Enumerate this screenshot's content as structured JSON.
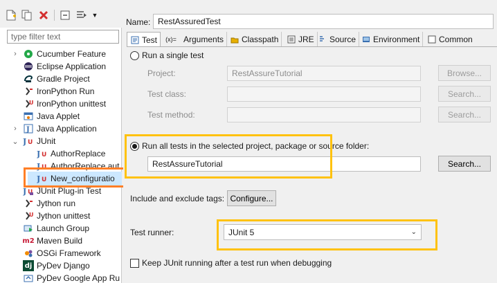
{
  "toolbar": {
    "new_icon": "new-launch-config-icon",
    "duplicate_icon": "duplicate-icon",
    "delete_icon": "delete-icon",
    "collapse_icon": "collapse-all-icon",
    "filter_icon": "filter-icon"
  },
  "filter": {
    "placeholder": "type filter text"
  },
  "tree": [
    {
      "label": "Cucumber Feature",
      "icon": "cucumber-icon"
    },
    {
      "label": "Eclipse Application",
      "icon": "eclipse-icon"
    },
    {
      "label": "Gradle Project",
      "icon": "gradle-icon"
    },
    {
      "label": "IronPython Run",
      "icon": "python-run-icon"
    },
    {
      "label": "IronPython unittest",
      "icon": "python-unittest-icon"
    },
    {
      "label": "Java Applet",
      "icon": "java-applet-icon"
    },
    {
      "label": "Java Application",
      "icon": "java-app-icon"
    },
    {
      "label": "JUnit",
      "icon": "junit-icon"
    },
    {
      "label": "AuthorReplace",
      "icon": "junit-icon"
    },
    {
      "label": "AuthorReplace aut",
      "icon": "junit-icon"
    },
    {
      "label": "New_configuratio",
      "icon": "junit-icon"
    },
    {
      "label": "JUnit Plug-in Test",
      "icon": "junit-plugin-icon"
    },
    {
      "label": "Jython run",
      "icon": "python-run-icon"
    },
    {
      "label": "Jython unittest",
      "icon": "python-unittest-icon"
    },
    {
      "label": "Launch Group",
      "icon": "launch-group-icon"
    },
    {
      "label": "Maven Build",
      "icon": "maven-icon"
    },
    {
      "label": "OSGi Framework",
      "icon": "osgi-icon"
    },
    {
      "label": "PyDev Django",
      "icon": "django-icon"
    },
    {
      "label": "PyDev Google App Ru",
      "icon": "google-app-icon"
    }
  ],
  "name_label": "Name:",
  "name_value": "RestAssuredTest",
  "tabs": [
    "Test",
    "Arguments",
    "Classpath",
    "JRE",
    "Source",
    "Environment",
    "Common"
  ],
  "run_single_label": "Run a single test",
  "project_label": "Project:",
  "project_value": "RestAssureTutorial",
  "browse_label": "Browse...",
  "test_class_label": "Test class:",
  "test_method_label": "Test method:",
  "search_label": "Search...",
  "run_all_label": "Run all tests in the selected project, package or source folder:",
  "container_value": "RestAssureTutorial",
  "include_exclude_label": "Include and exclude tags:",
  "configure_label": "Configure...",
  "test_runner_label": "Test runner:",
  "test_runner_value": "JUnit 5",
  "keep_running_label": "Keep JUnit running after a test run when debugging",
  "colors": {
    "orange_highlight": "#ff7f27",
    "yellow_highlight": "#ffc20e",
    "selection": "#cce8ff"
  }
}
